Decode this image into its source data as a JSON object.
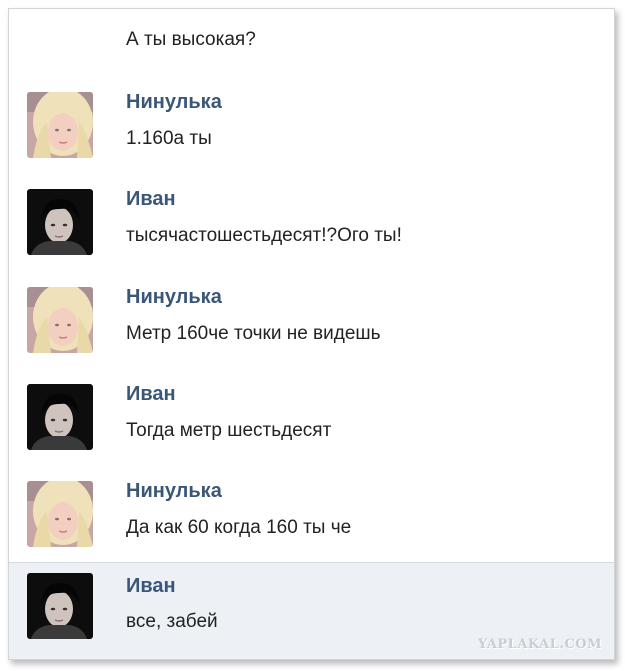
{
  "chat": {
    "continuation_text": "А ты высокая?",
    "messages": [
      {
        "author": "Нинулька",
        "text": "1.160а ты",
        "avatar": "girl-avatar"
      },
      {
        "author": "Иван",
        "text": "тысячастошестьдесят!?Ого ты!",
        "avatar": "boy-avatar"
      },
      {
        "author": "Нинулька",
        "text": "Метр 160че точки не видешь",
        "avatar": "girl-avatar"
      },
      {
        "author": "Иван",
        "text": "Тогда метр шестьдесят",
        "avatar": "boy-avatar"
      },
      {
        "author": "Нинулька",
        "text": "Да как 60 когда 160 ты че",
        "avatar": "girl-avatar"
      },
      {
        "author": "Иван",
        "text": "все, забей",
        "avatar": "boy-avatar"
      }
    ]
  },
  "watermark": "YAPLAKAL.COM",
  "colors": {
    "author_name": "#3a5777",
    "message_text": "#222222",
    "highlight_background": "#edf1f5"
  }
}
